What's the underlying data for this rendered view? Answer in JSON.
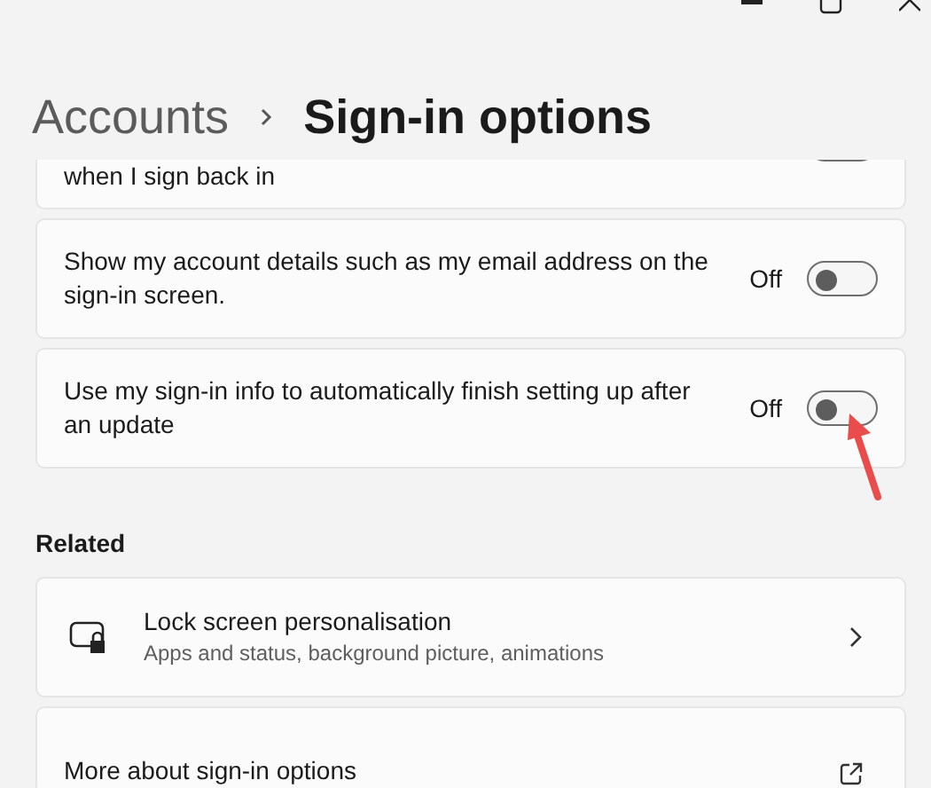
{
  "breadcrumb": {
    "parent": "Accounts",
    "current": "Sign-in options"
  },
  "settings": [
    {
      "text": "when I sign back in",
      "on": false,
      "cut": true
    },
    {
      "text": "Show my account details such as my email address on the sign-in screen.",
      "state_label": "Off",
      "on": false
    },
    {
      "text": "Use my sign-in info to automatically finish setting up after an update",
      "state_label": "Off",
      "on": false
    }
  ],
  "related": {
    "heading": "Related",
    "items": [
      {
        "kind": "navigate",
        "title": "Lock screen personalisation",
        "subtitle": "Apps and status, background picture, animations"
      },
      {
        "kind": "external",
        "title": "More about sign-in options"
      }
    ]
  }
}
